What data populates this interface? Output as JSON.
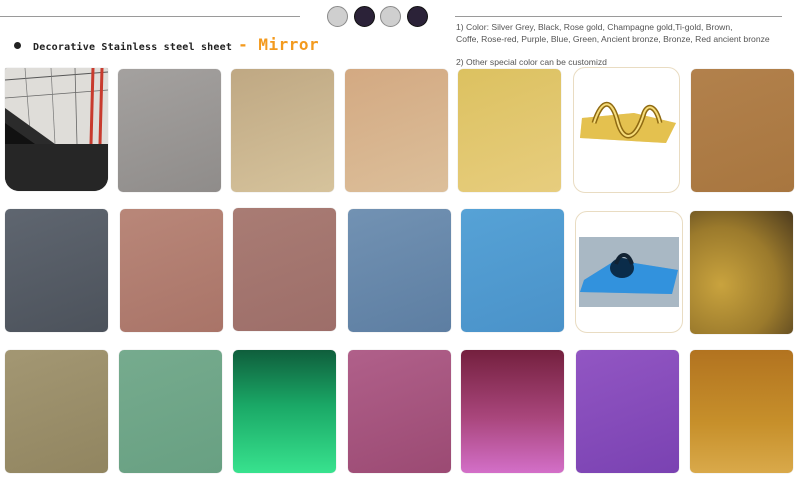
{
  "heading": {
    "title": "Decorative Stainless steel sheet",
    "accent": "- Mirror"
  },
  "notes": {
    "colors": "1) Color: Silver Grey, Black, Rose gold, Champagne gold,Ti-gold, Brown,",
    "colors_cont": "Coffe, Rose-red, Purple, Blue, Green, Ancient bronze, Bronze, Red ancient bronze",
    "custom": "2) Other special color can be customizd"
  },
  "header_dots": [
    "#cfcfcf",
    "#2b2238",
    "#cfcfcf",
    "#2b2238"
  ],
  "swatches": {
    "row1": [
      "photo-black",
      "#9b9896",
      "#c8b48e",
      "#d8b58f",
      "#e2c76e",
      "product-gold",
      "#b3834e"
    ],
    "row2": [
      "#59606a",
      "#b27f72",
      "#a4766f",
      "#6a89aa",
      "#4f9ace",
      "product-blue",
      "#a98a3a"
    ],
    "row3": [
      "#9b8f6a",
      "#6fa68a",
      "#22c47a",
      "#a8557c",
      "#a03a6e",
      "#8a4fba",
      "#c48a2a"
    ]
  }
}
